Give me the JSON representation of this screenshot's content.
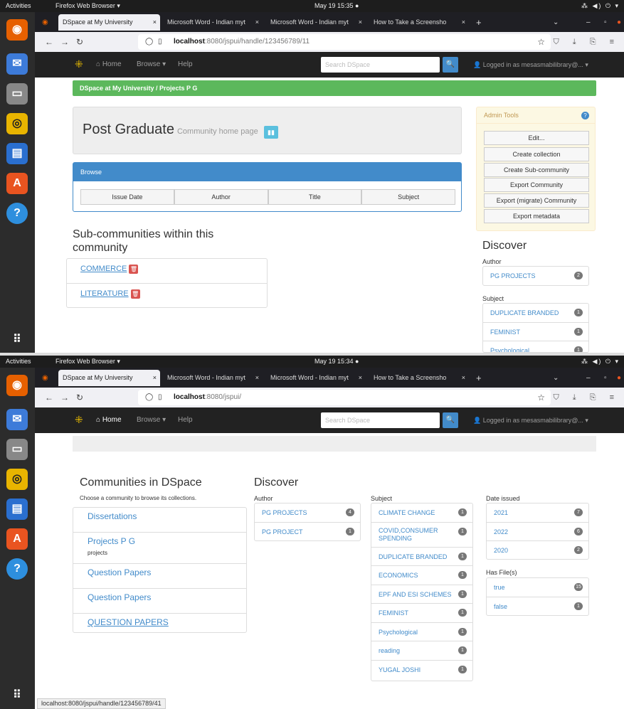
{
  "screenshots": [
    {
      "topbar": {
        "activities": "Activities",
        "app": "Firefox Web Browser ▾",
        "clock": "May 19  15:35  ●",
        "sys": "⁂ ◀) ⏻ ▾"
      },
      "tabs": [
        {
          "label": "DSpace at My University",
          "close": "×"
        },
        {
          "label": "Microsoft Word - Indian myt",
          "close": "×"
        },
        {
          "label": "Microsoft Word - Indian myt",
          "close": "×"
        },
        {
          "label": "How to Take a Screensho",
          "close": "×"
        }
      ],
      "new_tab": "+",
      "url": {
        "host": "localhost",
        "path": ":8080/jspui/handle/123456789/11",
        "star": "☆"
      },
      "nav": {
        "home": "Home",
        "browse": "Browse ▾",
        "help": "Help",
        "search_placeholder": "Search DSpace",
        "search_btn": "🔍",
        "user": "Logged in as mesasmabilibrary@... ▾"
      },
      "breadcrumb": "DSpace at My University  /  Projects P G",
      "jumbo": {
        "title": "Post Graduate",
        "subtitle": "Community home page"
      },
      "browse": {
        "header": "Browse",
        "buttons": [
          "Issue Date",
          "Author",
          "Title",
          "Subject"
        ]
      },
      "subcomm_heading_1": "Sub-communities within this",
      "subcomm_heading_2": "community",
      "subcommunities": [
        "COMMERCE",
        "LITERATURE"
      ],
      "admin": {
        "header": "Admin Tools",
        "help": "?",
        "buttons": [
          "Edit...",
          "Create collection",
          "Create Sub-community",
          "Export Community",
          "Export (migrate) Community",
          "Export metadata"
        ]
      },
      "discover": {
        "heading": "Discover",
        "author_label": "Author",
        "authors": [
          {
            "name": "PG PROJECTS",
            "count": "2"
          }
        ],
        "subject_label": "Subject",
        "subjects": [
          {
            "name": "DUPLICATE BRANDED",
            "count": "1"
          },
          {
            "name": "FEMINIST",
            "count": "1"
          },
          {
            "name": "Psychological",
            "count": "1"
          }
        ]
      }
    },
    {
      "topbar": {
        "activities": "Activities",
        "app": "Firefox Web Browser ▾",
        "clock": "May 19  15:34  ●",
        "sys": "⁂ ◀) ⏻ ▾"
      },
      "tabs": [
        {
          "label": "DSpace at My University",
          "close": "×"
        },
        {
          "label": "Microsoft Word - Indian myt",
          "close": "×"
        },
        {
          "label": "Microsoft Word - Indian myt",
          "close": "×"
        },
        {
          "label": "How to Take a Screensho",
          "close": "×"
        }
      ],
      "new_tab": "+",
      "url": {
        "host": "localhost",
        "path": ":8080/jspui/",
        "star": "☆"
      },
      "nav": {
        "home": "Home",
        "browse": "Browse ▾",
        "help": "Help",
        "search_placeholder": "Search DSpace",
        "search_btn": "🔍",
        "user": "Logged in as mesasmabilibrary@... ▾"
      },
      "communities": {
        "heading": "Communities in DSpace",
        "hint": "Choose a community to browse its collections.",
        "items": [
          {
            "name": "Dissertations",
            "desc": ""
          },
          {
            "name": "Projects P G",
            "desc": "projects"
          },
          {
            "name": "Question Papers",
            "desc": ""
          },
          {
            "name": "Question Papers",
            "desc": ""
          },
          {
            "name": "QUESTION PAPERS",
            "desc": ""
          }
        ]
      },
      "discover": {
        "heading": "Discover",
        "author_label": "Author",
        "authors": [
          {
            "name": "PG PROJECTS",
            "count": "4"
          },
          {
            "name": "PG PROJECT",
            "count": "1"
          }
        ],
        "subject_label": "Subject",
        "subjects": [
          {
            "name": "CLIMATE CHANGE",
            "count": "1"
          },
          {
            "name": "COVID,CONSUMER SPENDING",
            "count": "1"
          },
          {
            "name": "DUPLICATE BRANDED",
            "count": "1"
          },
          {
            "name": "ECONOMICS",
            "count": "1"
          },
          {
            "name": "EPF AND ESI SCHEMES",
            "count": "1"
          },
          {
            "name": "FEMINIST",
            "count": "1"
          },
          {
            "name": "Psychological",
            "count": "1"
          },
          {
            "name": "reading",
            "count": "1"
          },
          {
            "name": "YUGAL JOSHI",
            "count": "1"
          }
        ],
        "date_label": "Date issued",
        "dates": [
          {
            "name": "2021",
            "count": "7"
          },
          {
            "name": "2022",
            "count": "6"
          },
          {
            "name": "2020",
            "count": "2"
          }
        ],
        "files_label": "Has File(s)",
        "files": [
          {
            "name": "true",
            "count": "15"
          },
          {
            "name": "false",
            "count": "1"
          }
        ]
      },
      "status": "localhost:8080/jspui/handle/123456789/41"
    }
  ]
}
